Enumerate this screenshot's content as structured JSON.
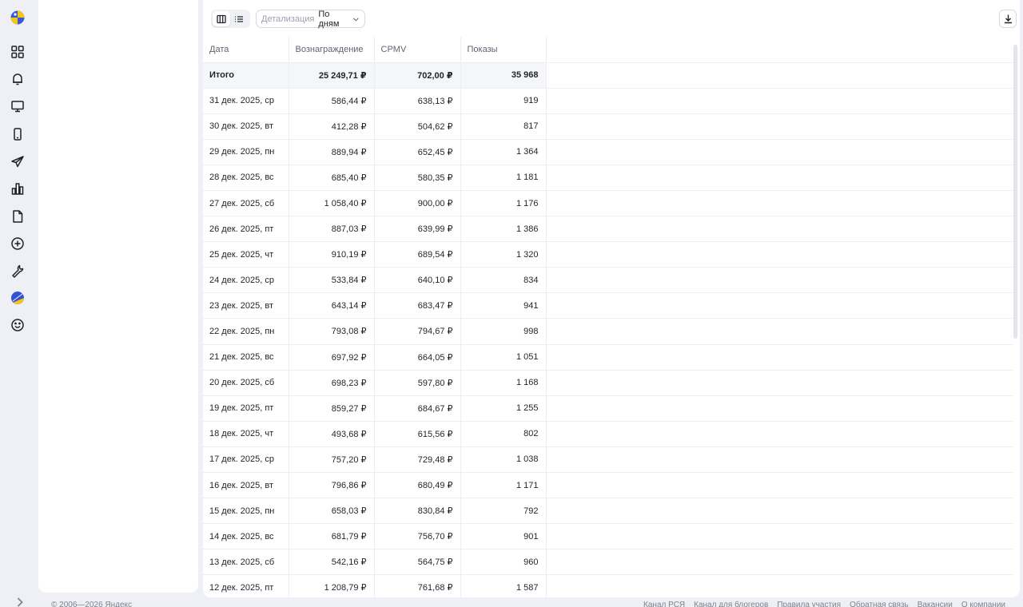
{
  "rail": {
    "icons": [
      "logo-icon",
      "grid-icon",
      "bell-icon",
      "monitor-icon",
      "phone-icon",
      "send-icon",
      "bar-chart-icon",
      "document-icon",
      "plus-circle-icon",
      "wrench-icon",
      "palette-icon",
      "smile-icon"
    ],
    "expand_icon": "chevron-right-icon"
  },
  "toolbar": {
    "detail_label": "Детализация",
    "detail_value": "По дням"
  },
  "table": {
    "headers": [
      "Дата",
      "Вознаграждение",
      "CPMV",
      "Показы"
    ],
    "total": {
      "label": "Итого",
      "reward": "25 249,71 ₽",
      "cpmv": "702,00 ₽",
      "shows": "35 968"
    },
    "rows": [
      {
        "date": "31 дек. 2025, ср",
        "reward": "586,44 ₽",
        "cpmv": "638,13 ₽",
        "shows": "919"
      },
      {
        "date": "30 дек. 2025, вт",
        "reward": "412,28 ₽",
        "cpmv": "504,62 ₽",
        "shows": "817"
      },
      {
        "date": "29 дек. 2025, пн",
        "reward": "889,94 ₽",
        "cpmv": "652,45 ₽",
        "shows": "1 364"
      },
      {
        "date": "28 дек. 2025, вс",
        "reward": "685,40 ₽",
        "cpmv": "580,35 ₽",
        "shows": "1 181"
      },
      {
        "date": "27 дек. 2025, сб",
        "reward": "1 058,40 ₽",
        "cpmv": "900,00 ₽",
        "shows": "1 176"
      },
      {
        "date": "26 дек. 2025, пт",
        "reward": "887,03 ₽",
        "cpmv": "639,99 ₽",
        "shows": "1 386"
      },
      {
        "date": "25 дек. 2025, чт",
        "reward": "910,19 ₽",
        "cpmv": "689,54 ₽",
        "shows": "1 320"
      },
      {
        "date": "24 дек. 2025, ср",
        "reward": "533,84 ₽",
        "cpmv": "640,10 ₽",
        "shows": "834"
      },
      {
        "date": "23 дек. 2025, вт",
        "reward": "643,14 ₽",
        "cpmv": "683,47 ₽",
        "shows": "941"
      },
      {
        "date": "22 дек. 2025, пн",
        "reward": "793,08 ₽",
        "cpmv": "794,67 ₽",
        "shows": "998"
      },
      {
        "date": "21 дек. 2025, вс",
        "reward": "697,92 ₽",
        "cpmv": "664,05 ₽",
        "shows": "1 051"
      },
      {
        "date": "20 дек. 2025, сб",
        "reward": "698,23 ₽",
        "cpmv": "597,80 ₽",
        "shows": "1 168"
      },
      {
        "date": "19 дек. 2025, пт",
        "reward": "859,27 ₽",
        "cpmv": "684,67 ₽",
        "shows": "1 255"
      },
      {
        "date": "18 дек. 2025, чт",
        "reward": "493,68 ₽",
        "cpmv": "615,56 ₽",
        "shows": "802"
      },
      {
        "date": "17 дек. 2025, ср",
        "reward": "757,20 ₽",
        "cpmv": "729,48 ₽",
        "shows": "1 038"
      },
      {
        "date": "16 дек. 2025, вт",
        "reward": "796,86 ₽",
        "cpmv": "680,49 ₽",
        "shows": "1 171"
      },
      {
        "date": "15 дек. 2025, пн",
        "reward": "658,03 ₽",
        "cpmv": "830,84 ₽",
        "shows": "792"
      },
      {
        "date": "14 дек. 2025, вс",
        "reward": "681,79 ₽",
        "cpmv": "756,70 ₽",
        "shows": "901"
      },
      {
        "date": "13 дек. 2025, сб",
        "reward": "542,16 ₽",
        "cpmv": "564,75 ₽",
        "shows": "960"
      },
      {
        "date": "12 дек. 2025, пт",
        "reward": "1 208,79 ₽",
        "cpmv": "761,68 ₽",
        "shows": "1 587"
      }
    ]
  },
  "footer": {
    "copyright": "© 2006—2026 Яндекс",
    "links": [
      "Канал РСЯ",
      "Канал для блогеров",
      "Правила участия",
      "Обратная связь",
      "Вакансии",
      "О компании"
    ]
  }
}
